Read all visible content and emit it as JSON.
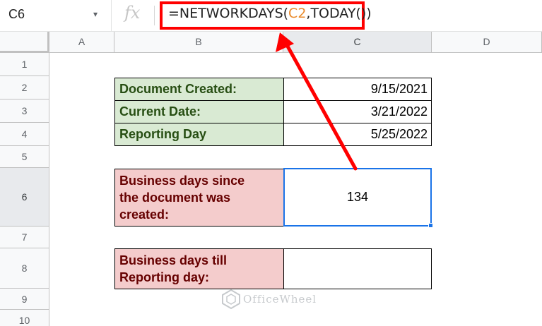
{
  "formula_bar": {
    "name_box": "C6",
    "name_box_arrow": "▾",
    "fx": "fx",
    "formula_prefix": "=NETWORKDAYS(",
    "formula_ref": "C2",
    "formula_suffix": ",TODAY())"
  },
  "columns": [
    "A",
    "B",
    "C",
    "D"
  ],
  "rows": [
    "1",
    "2",
    "3",
    "4",
    "5",
    "6",
    "7",
    "8",
    "9",
    "10"
  ],
  "table1": [
    {
      "label": "Document Created:",
      "value": "9/15/2021"
    },
    {
      "label": "Current Date:",
      "value": "3/21/2022"
    },
    {
      "label": "Reporting Day",
      "value": "5/25/2022"
    }
  ],
  "table2": [
    {
      "label_lines": [
        "Business days since",
        "the document was",
        "created:"
      ],
      "value": "134"
    },
    {
      "label_lines": [
        "Business days till",
        "Reporting day:"
      ],
      "value": ""
    }
  ],
  "watermark": "OfficeWheel",
  "colors": {
    "highlight_red": "#ff0000",
    "selection_blue": "#1a73e8",
    "label_green": "#d9ead3",
    "label_pink": "#f4cccc"
  }
}
